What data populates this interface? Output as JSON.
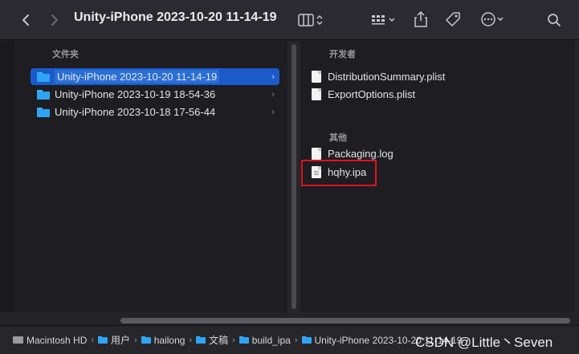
{
  "toolbar": {
    "title": "Unity-iPhone 2023-10-20 11-14-19",
    "back_icon": "chevron-left-icon",
    "forward_icon": "chevron-right-icon",
    "view_icon": "column-view-icon",
    "group_icon": "group-grid-icon",
    "share_icon": "share-icon",
    "tag_icon": "tag-icon",
    "more_icon": "ellipsis-circle-icon",
    "search_icon": "search-icon"
  },
  "left_pane": {
    "header": "文件夹",
    "items": [
      {
        "label": "Unity-iPhone 2023-10-20 11-14-19",
        "selected": true
      },
      {
        "label": "Unity-iPhone 2023-10-19 18-54-36",
        "selected": false
      },
      {
        "label": "Unity-iPhone 2023-10-18 17-56-44",
        "selected": false
      }
    ]
  },
  "right_pane": {
    "developer_header": "开发者",
    "developer_items": [
      {
        "label": "DistributionSummary.plist"
      },
      {
        "label": "ExportOptions.plist"
      }
    ],
    "other_header": "其他",
    "other_items": [
      {
        "label": "Packaging.log"
      },
      {
        "label": "hqhy.ipa",
        "highlighted": true
      }
    ]
  },
  "pathbar": {
    "crumbs": [
      "Macintosh HD",
      "用户",
      "hailong",
      "文稿",
      "build_ipa",
      "Unity-iPhone 2023-10-20 11-14-19"
    ],
    "separator": "›"
  },
  "watermark": "CSDN @Little丶Seven",
  "colors": {
    "selection": "#1a5ac9",
    "folder": "#2ea4f5",
    "highlight_box": "#e0121a"
  }
}
